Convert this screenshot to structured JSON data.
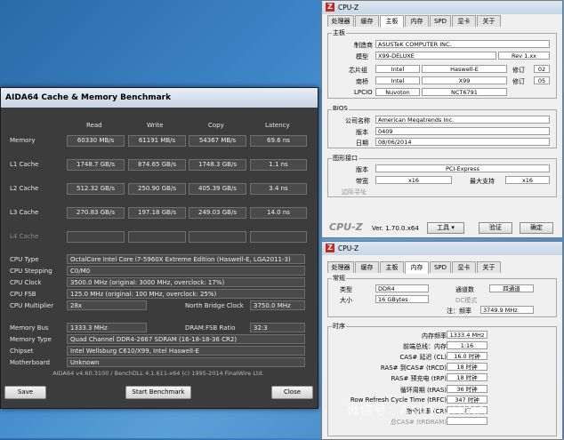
{
  "aida": {
    "title": "AIDA64 Cache & Memory Benchmark",
    "columns": [
      "Read",
      "Write",
      "Copy",
      "Latency"
    ],
    "rows": [
      {
        "label": "Memory",
        "read": "60330 MB/s",
        "write": "61191 MB/s",
        "copy": "54367 MB/s",
        "latency": "69.6 ns"
      },
      {
        "label": "L1 Cache",
        "read": "1748.7 GB/s",
        "write": "874.65 GB/s",
        "copy": "1748.3 GB/s",
        "latency": "1.1 ns"
      },
      {
        "label": "L2 Cache",
        "read": "512.32 GB/s",
        "write": "250.90 GB/s",
        "copy": "405.39 GB/s",
        "latency": "3.4 ns"
      },
      {
        "label": "L3 Cache",
        "read": "270.83 GB/s",
        "write": "197.18 GB/s",
        "copy": "249.03 GB/s",
        "latency": "14.0 ns"
      },
      {
        "label": "L4 Cache",
        "read": "",
        "write": "",
        "copy": "",
        "latency": ""
      }
    ],
    "info": {
      "cpu_type_label": "CPU Type",
      "cpu_type": "OctalCore Intel Core i7-5960X Extreme Edition  (Haswell-E, LGA2011-3)",
      "cpu_stepping_label": "CPU Stepping",
      "cpu_stepping": "C0/M0",
      "cpu_clock_label": "CPU Clock",
      "cpu_clock": "3500.0 MHz  (original: 3000 MHz, overclock: 17%)",
      "cpu_fsb_label": "CPU FSB",
      "cpu_fsb": "125.0 MHz  (original: 100 MHz, overclock: 25%)",
      "cpu_mult_label": "CPU Multiplier",
      "cpu_mult": "28x",
      "nb_clock_label": "North Bridge Clock",
      "nb_clock": "3750.0 MHz",
      "mem_bus_label": "Memory Bus",
      "mem_bus": "1333.3 MHz",
      "dram_fsb_label": "DRAM:FSB Ratio",
      "dram_fsb": "32:3",
      "mem_type_label": "Memory Type",
      "mem_type": "Quad Channel DDR4-2667 SDRAM  (16-18-18-36 CR2)",
      "chipset_label": "Chipset",
      "chipset": "Intel Wellsburg C610/X99, Intel Haswell-E",
      "mb_label": "Motherboard",
      "mb": "Unknown"
    },
    "footer": "AIDA64 v4.60.3100 / BenchDLL 4.1.611-x64  (c) 1995-2014 FinalWire Ltd.",
    "save": "Save",
    "start": "Start Benchmark",
    "close": "Close"
  },
  "cpuz1": {
    "title": "CPU-Z",
    "tabs": [
      "处理器",
      "缓存",
      "主板",
      "内存",
      "SPD",
      "显卡",
      "关于"
    ],
    "mb_group": "主板",
    "manufacturer_label": "制造商",
    "manufacturer": "ASUSTeK COMPUTER INC.",
    "model_label": "模型",
    "model": "X99-DELUXE",
    "rev": "Rev 1.xx",
    "chipset_label": "芯片组",
    "chipset_vendor": "Intel",
    "chipset_name": "Haswell-E",
    "chipset_rev_label": "修订",
    "chipset_rev": "02",
    "south_label": "南桥",
    "south_vendor": "Intel",
    "south_name": "X99",
    "south_rev_label": "修订",
    "south_rev": "05",
    "lpcio_label": "LPCIO",
    "lpcio_vendor": "Nuvoton",
    "lpcio_name": "NCT6791",
    "bios_group": "BIOS",
    "brand_label": "公司名称",
    "brand": "American Megatrends Inc.",
    "version_label": "版本",
    "version": "0409",
    "date_label": "日期",
    "date": "08/06/2014",
    "gfx_group": "图形接口",
    "gver_label": "版本",
    "gver": "PCI-Express",
    "width_label": "带宽",
    "width": "x16",
    "maxsup_label": "最大支持",
    "maxsup": "x16",
    "side_label": "边际寻址",
    "version_text": "Ver. 1.70.0.x64",
    "tools": "工具",
    "validate": "验证",
    "ok": "确定"
  },
  "cpuz2": {
    "title": "CPU-Z",
    "tabs": [
      "处理器",
      "缓存",
      "主板",
      "内存",
      "SPD",
      "显卡",
      "关于"
    ],
    "general_group": "常规",
    "type_label": "类型",
    "type": "DDR4",
    "channels_label": "通道数",
    "channels": "四通道",
    "size_label": "大小",
    "size": "16 GBytes",
    "dc_label": "DC模式",
    "nbfreq_label": "注：频率",
    "nbfreq": "3749.9 MHz",
    "timings_group": "时序",
    "timings": [
      {
        "label": "内存频率",
        "value": "1333.4 MHz"
      },
      {
        "label": "前端总线：内存",
        "value": "1:16"
      },
      {
        "label": "CAS# 延迟 (CL)",
        "value": "16.0 时钟"
      },
      {
        "label": "RAS# 到CAS# (tRCD)",
        "value": "18 时钟"
      },
      {
        "label": "RAS# 预充电 (tRP)",
        "value": "18 时钟"
      },
      {
        "label": "循环周期 (tRAS)",
        "value": "36 时钟"
      },
      {
        "label": "Row Refresh Cycle Time (tRFC)",
        "value": "347 时钟"
      },
      {
        "label": "指令比率 (CR)",
        "value": "2T"
      },
      {
        "label": "总CAS# (tRDRAM)",
        "value": ""
      }
    ]
  },
  "watermark": "微信号：ASUS-CHINA"
}
